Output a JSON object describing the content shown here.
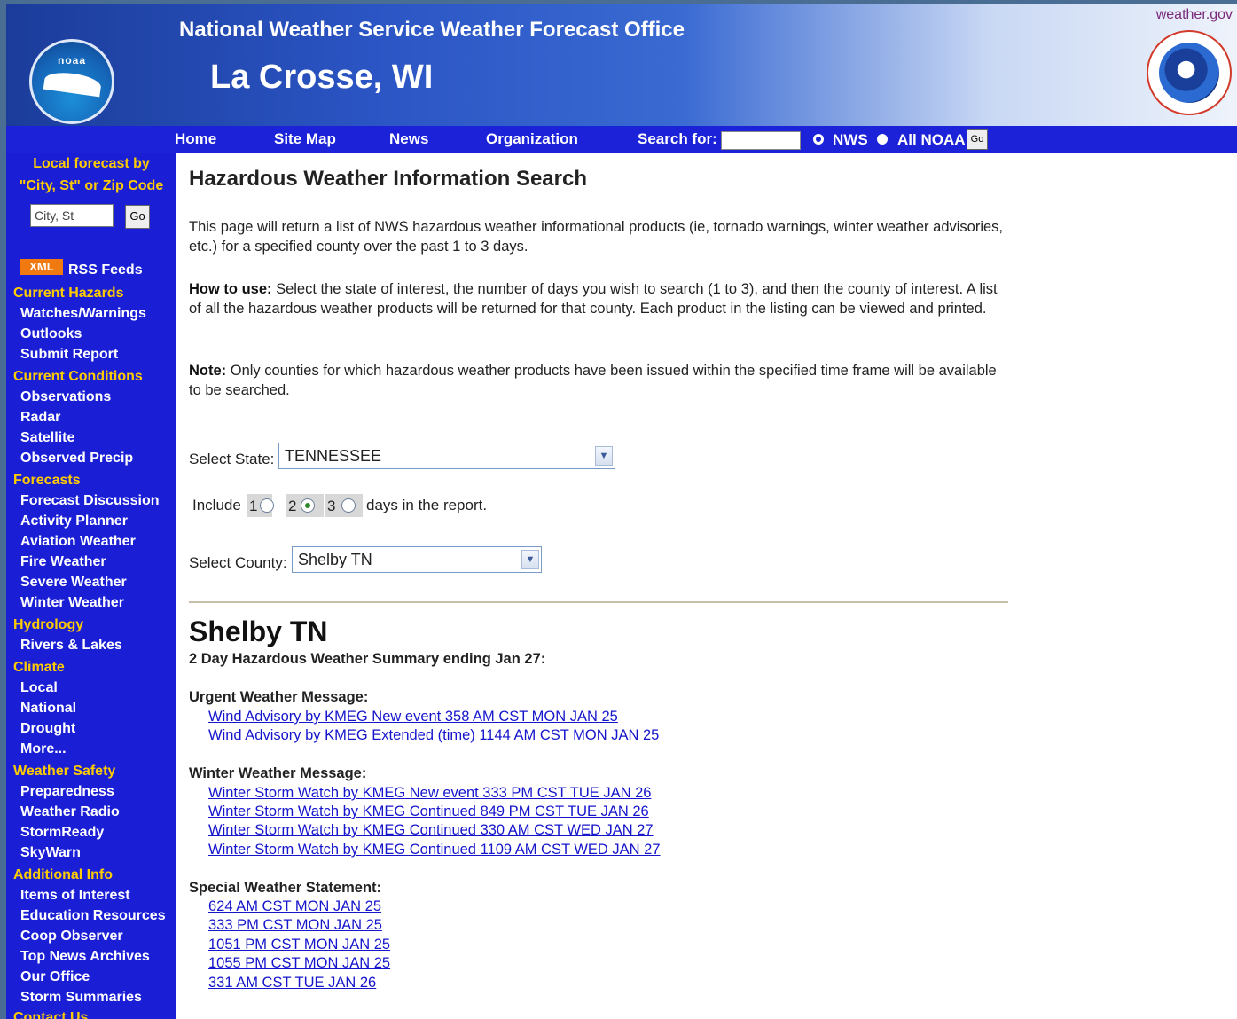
{
  "header": {
    "office_line": "National Weather Service Weather Forecast Office",
    "city": "La Crosse, WI",
    "weather_gov": "weather.gov",
    "noaa_logo_text": "noaa",
    "seal_name": "nws-seal"
  },
  "nav": {
    "items": [
      "Home",
      "Site Map",
      "News",
      "Organization"
    ],
    "search_label": "Search for:",
    "search_value": "",
    "radio_nws": "NWS",
    "radio_allnoaa": "All NOAA",
    "go": "Go"
  },
  "sidebar": {
    "local_forecast": "Local forecast by \"City, St\" or Zip Code",
    "city_placeholder": "City, St",
    "go": "Go",
    "xml_badge": "XML",
    "rss": "RSS Feeds",
    "sections": [
      {
        "heading": "Current Hazards",
        "items": [
          "Watches/Warnings",
          "Outlooks",
          "Submit Report"
        ]
      },
      {
        "heading": "Current Conditions",
        "items": [
          "Observations",
          "Radar",
          "Satellite",
          "Observed Precip"
        ]
      },
      {
        "heading": "Forecasts",
        "items": [
          "Forecast Discussion",
          "Activity Planner",
          "Aviation Weather",
          "Fire Weather",
          "Severe Weather",
          "Winter Weather"
        ]
      },
      {
        "heading": "Hydrology",
        "items": [
          "Rivers & Lakes"
        ]
      },
      {
        "heading": "Climate",
        "items": [
          "Local",
          "National",
          "Drought",
          "More..."
        ]
      },
      {
        "heading": "Weather Safety",
        "items": [
          "Preparedness",
          "Weather Radio",
          "StormReady",
          "SkyWarn"
        ]
      },
      {
        "heading": "Additional Info",
        "items": [
          "Items of Interest",
          "Education Resources",
          "Coop Observer",
          "Top News Archives",
          "Our Office",
          "Storm Summaries"
        ]
      },
      {
        "heading": "Contact Us",
        "items": []
      }
    ]
  },
  "main": {
    "title": "Hazardous Weather Information Search",
    "intro": "This page will return a list of NWS hazardous weather informational products (ie, tornado warnings, winter weather advisories, etc.) for a specified county over the past 1 to 3 days.",
    "how_label": "How to use:",
    "how_text": " Select the state of interest, the number of days you wish to search (1 to 3), and then the county of interest. A list of all the hazardous weather products will be returned for that county. Each product in the listing can be viewed and printed.",
    "note_label": "Note:",
    "note_text": " Only counties for which hazardous weather products have been issued within the specified time frame will be available to be searched.",
    "state_label": "Select State:",
    "state_value": "TENNESSEE",
    "include_label": "Include",
    "days": [
      "1",
      "2",
      "3"
    ],
    "days_selected": "2",
    "days_suffix": "days in the report.",
    "county_label": "Select County:",
    "county_value": "Shelby TN",
    "county_heading": "Shelby TN",
    "summary": "2 Day Hazardous Weather Summary ending Jan 27:",
    "groups": [
      {
        "title": "Urgent Weather Message:",
        "links": [
          "Wind Advisory by KMEG New event 358 AM CST MON JAN 25",
          "Wind Advisory by KMEG Extended (time) 1144 AM CST MON JAN 25"
        ]
      },
      {
        "title": "Winter Weather Message:",
        "links": [
          "Winter Storm Watch by KMEG New event 333 PM CST TUE JAN 26",
          "Winter Storm Watch by KMEG Continued 849 PM CST TUE JAN 26",
          "Winter Storm Watch by KMEG Continued 330 AM CST WED JAN 27",
          "Winter Storm Watch by KMEG Continued 1109 AM CST WED JAN 27"
        ]
      },
      {
        "title": "Special Weather Statement:",
        "links": [
          "624 AM CST MON JAN 25",
          "333 PM CST MON JAN 25",
          "1051 PM CST MON JAN 25",
          "1055 PM CST MON JAN 25",
          "331 AM CST TUE JAN 26"
        ]
      }
    ]
  }
}
